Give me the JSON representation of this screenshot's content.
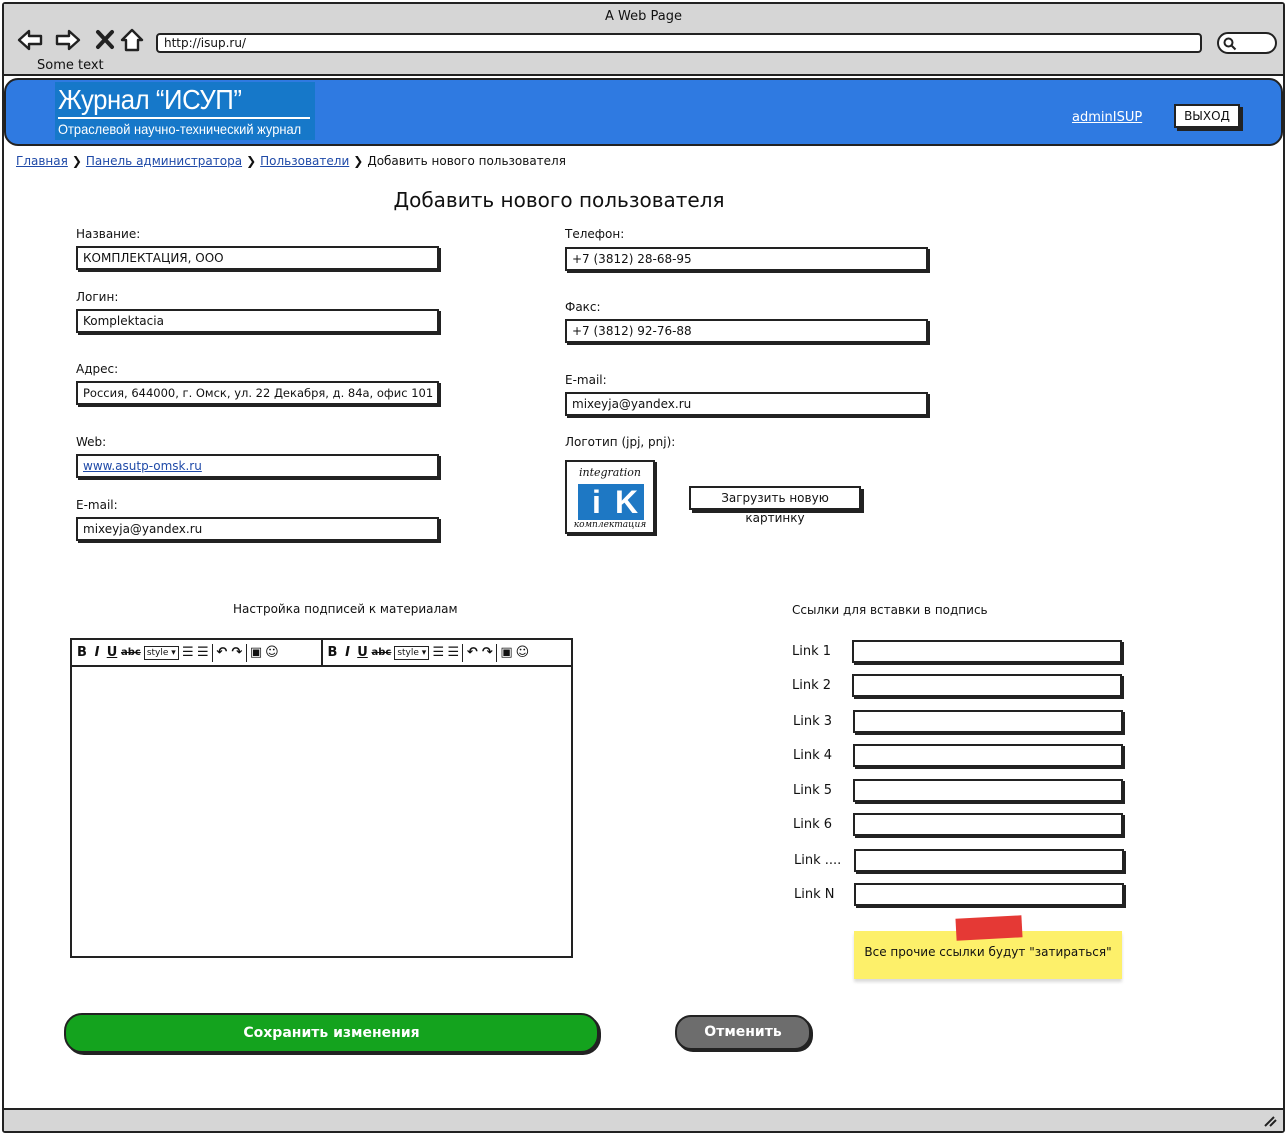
{
  "browser": {
    "window_title": "A Web Page",
    "url": "http://isup.ru/",
    "status_text": "Some text"
  },
  "header": {
    "logo_title": "Журнал “ИСУП”",
    "logo_subtitle": "Отраслевой научно-технический журнал",
    "user_link": "adminISUP",
    "logout_label": "ВЫХОД",
    "color": "#2f7ae1"
  },
  "breadcrumb": [
    {
      "label": "Главная",
      "link": true
    },
    {
      "label": "Панель администратора",
      "link": true
    },
    {
      "label": "Пользователи",
      "link": true
    },
    {
      "label": "Добавить нового пользователя",
      "link": false
    }
  ],
  "page_title": "Добавить нового пользователя",
  "form": {
    "name_label": "Название:",
    "name_value": "КОМПЛЕКТАЦИЯ, ООО",
    "login_label": "Логин:",
    "login_value": "Komplektacia",
    "address_label": "Адрес:",
    "address_value": "Россия, 644000, г. Омск, ул. 22 Декабря, д. 84а, офис 101",
    "web_label": "Web:",
    "web_value": "www.asutp-omsk.ru",
    "email_left_label": "E-mail:",
    "email_left_value": "mixeyja@yandex.ru",
    "phone_label": "Телефон:",
    "phone_value": "+7 (3812) 28-68-95",
    "fax_label": "Факс:",
    "fax_value": "+7 (3812) 92-76-88",
    "email_right_label": "E-mail:",
    "email_right_value": "mixeyja@yandex.ru",
    "logo_label": "Логотип (jpj, pnj):",
    "logo_text_top": "integration",
    "logo_letter_1": "i",
    "logo_letter_2": "K",
    "logo_text_bottom": "комплектация",
    "upload_label": "Загрузить новую картинку"
  },
  "signature": {
    "title": "Настройка подписей к материалам",
    "toolbar_style_label": "style"
  },
  "links": {
    "title": "Ссылки для вставки в подпись",
    "items": [
      "Link 1",
      "Link 2",
      "Link 3",
      "Link 4",
      "Link 5",
      "Link 6",
      "Link ....",
      "Link N"
    ],
    "note": "Все прочие ссылки будут \"затираться\""
  },
  "actions": {
    "save_label": "Сохранить изменения",
    "save_color": "#14a31e",
    "cancel_label": "Отменить",
    "cancel_color": "#6d6d6d"
  }
}
